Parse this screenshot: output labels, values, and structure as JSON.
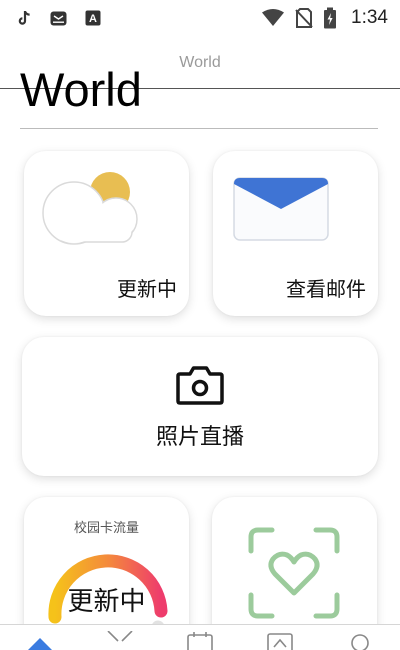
{
  "status_bar": {
    "time": "1:34",
    "left_icons": [
      "tiktok-icon",
      "news-app-icon",
      "text-app-icon"
    ],
    "right_icons": [
      "wifi-icon",
      "no-sim-icon",
      "battery-charging-icon"
    ]
  },
  "header": {
    "small_title": "World",
    "large_title": "World"
  },
  "cards": {
    "weather": {
      "label": "更新中",
      "icon": "weather-partly-cloudy-icon"
    },
    "mail": {
      "label": "查看邮件",
      "icon": "mail-envelope-icon"
    },
    "photo": {
      "label": "照片直播",
      "icon": "camera-icon"
    },
    "campus_card": {
      "title": "校园卡流量",
      "value": "更新中",
      "icon": "gauge-ring"
    },
    "health": {
      "icon": "heart-scan-icon"
    }
  },
  "bottom_nav": {
    "items": [
      "home-icon",
      "explore-icon",
      "calendar-icon",
      "profile-card-icon",
      "search-icon"
    ]
  },
  "colors": {
    "accent_blue": "#3a7be0",
    "mail_blue": "#3f74d4",
    "health_green": "#9ccb9c",
    "sun_yellow": "#e8be52",
    "gauge_start": "#f5c21a",
    "gauge_end": "#ee3c6c"
  }
}
